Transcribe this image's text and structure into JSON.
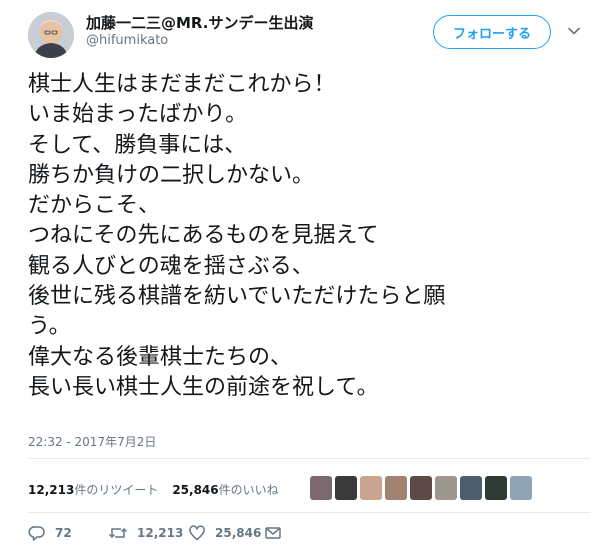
{
  "header": {
    "display_name": "加藤一二三@MR.サンデー生出演",
    "handle": "@hifumikato",
    "follow_label": "フォローする"
  },
  "tweet": {
    "lines": [
      "棋士人生はまだまだこれから！",
      "いま始まったばかり。",
      "そして、勝負事には、",
      "勝ちか負けの二択しかない。",
      "だからこそ、",
      "つねにその先にあるものを見据えて",
      "観る人びとの魂を揺さぶる、",
      "後世に残る棋譜を紡いでいただけたらと願",
      "う。",
      "偉大なる後輩棋士たちの、",
      "長い長い棋士人生の前途を祝して。"
    ],
    "timestamp": "22:32 - 2017年7月2日"
  },
  "stats": {
    "retweet_count": "12,213",
    "retweet_label": "件のリツイート",
    "like_count": "25,846",
    "like_label": "件のいいね"
  },
  "actions": {
    "reply_count": "72",
    "retweet_count": "12,213",
    "like_count": "25,846"
  },
  "colors": {
    "accent": "#1da1f2",
    "text": "#14171a",
    "secondary_text": "#657786",
    "divider": "#e6ecf0"
  },
  "icons": {
    "reply": "reply-icon",
    "retweet": "retweet-icon",
    "like": "heart-icon",
    "dm": "envelope-icon",
    "menu": "chevron-down-icon"
  }
}
